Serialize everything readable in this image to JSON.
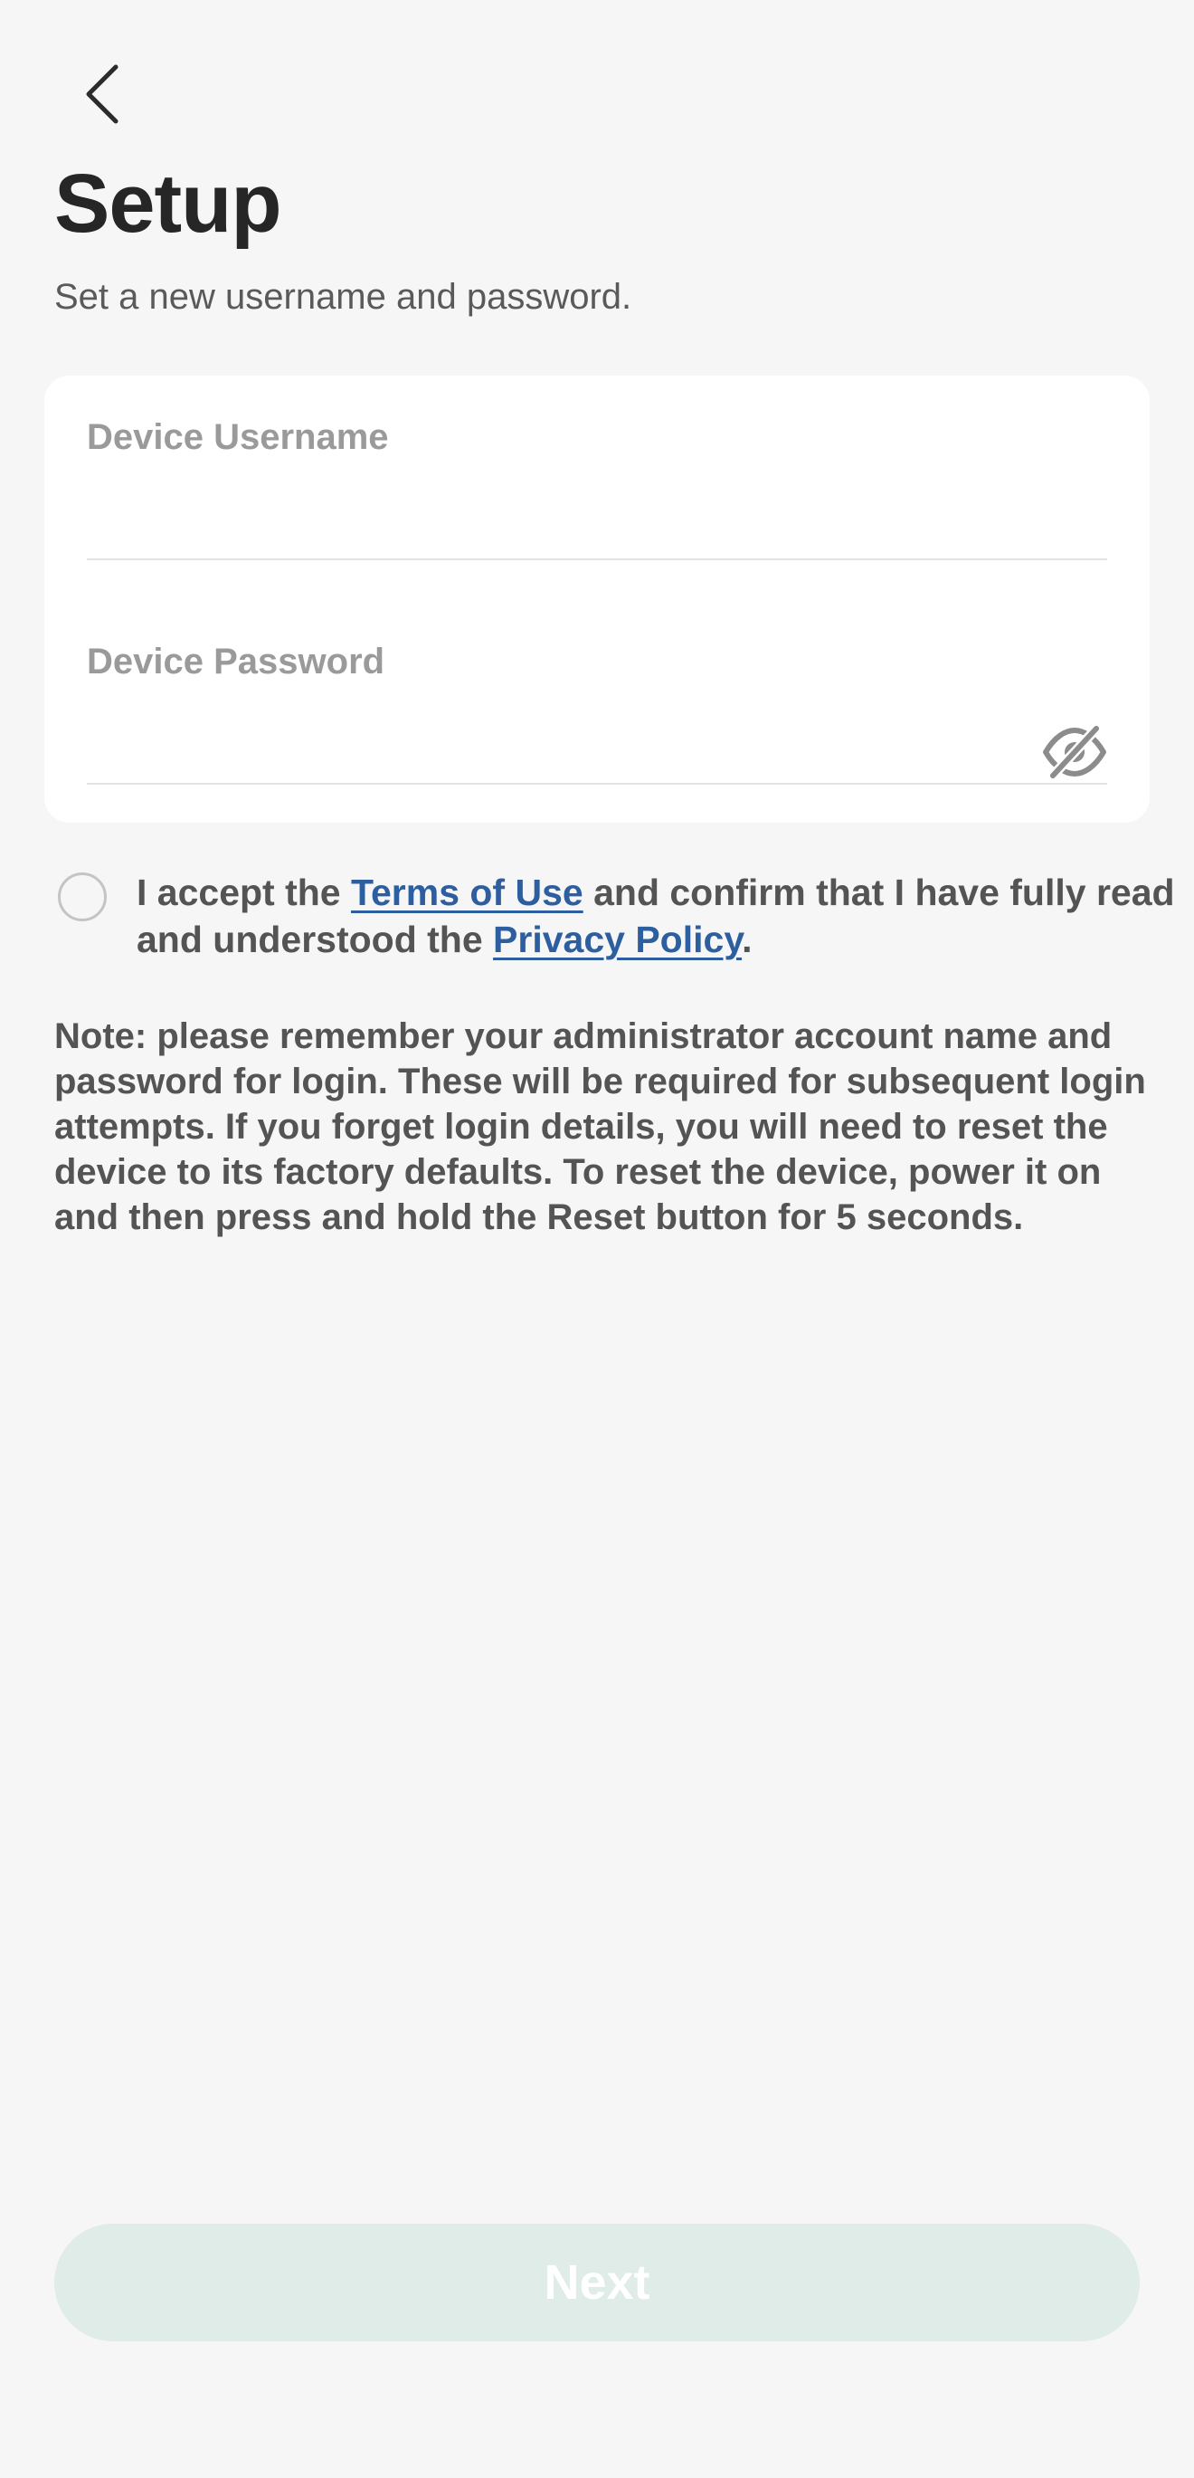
{
  "header": {
    "back_icon": "chevron-left-icon",
    "title": "Setup",
    "subtitle": "Set a new username and password."
  },
  "form": {
    "username": {
      "label": "Device Username",
      "value": ""
    },
    "password": {
      "label": "Device Password",
      "value": "",
      "visibility_icon": "eye-off-icon"
    }
  },
  "consent": {
    "checked": false,
    "text_before": "I accept the ",
    "terms_link": "Terms of Use",
    "text_middle": " and confirm that I have fully read and understood the ",
    "privacy_link": "Privacy Policy",
    "text_after": "."
  },
  "note": "Note: please remember your administrator account name and password for login. These will be required for subsequent login attempts. If you forget login details, you will need to reset the device to its factory defaults. To reset the device, power it on and then press and hold the Reset button for 5 seconds.",
  "footer": {
    "next_label": "Next",
    "next_enabled": false
  },
  "colors": {
    "background": "#f6f6f6",
    "card": "#ffffff",
    "link": "#2d5fa0",
    "next_disabled_bg": "#dfece8",
    "label": "#9a9a9a"
  }
}
